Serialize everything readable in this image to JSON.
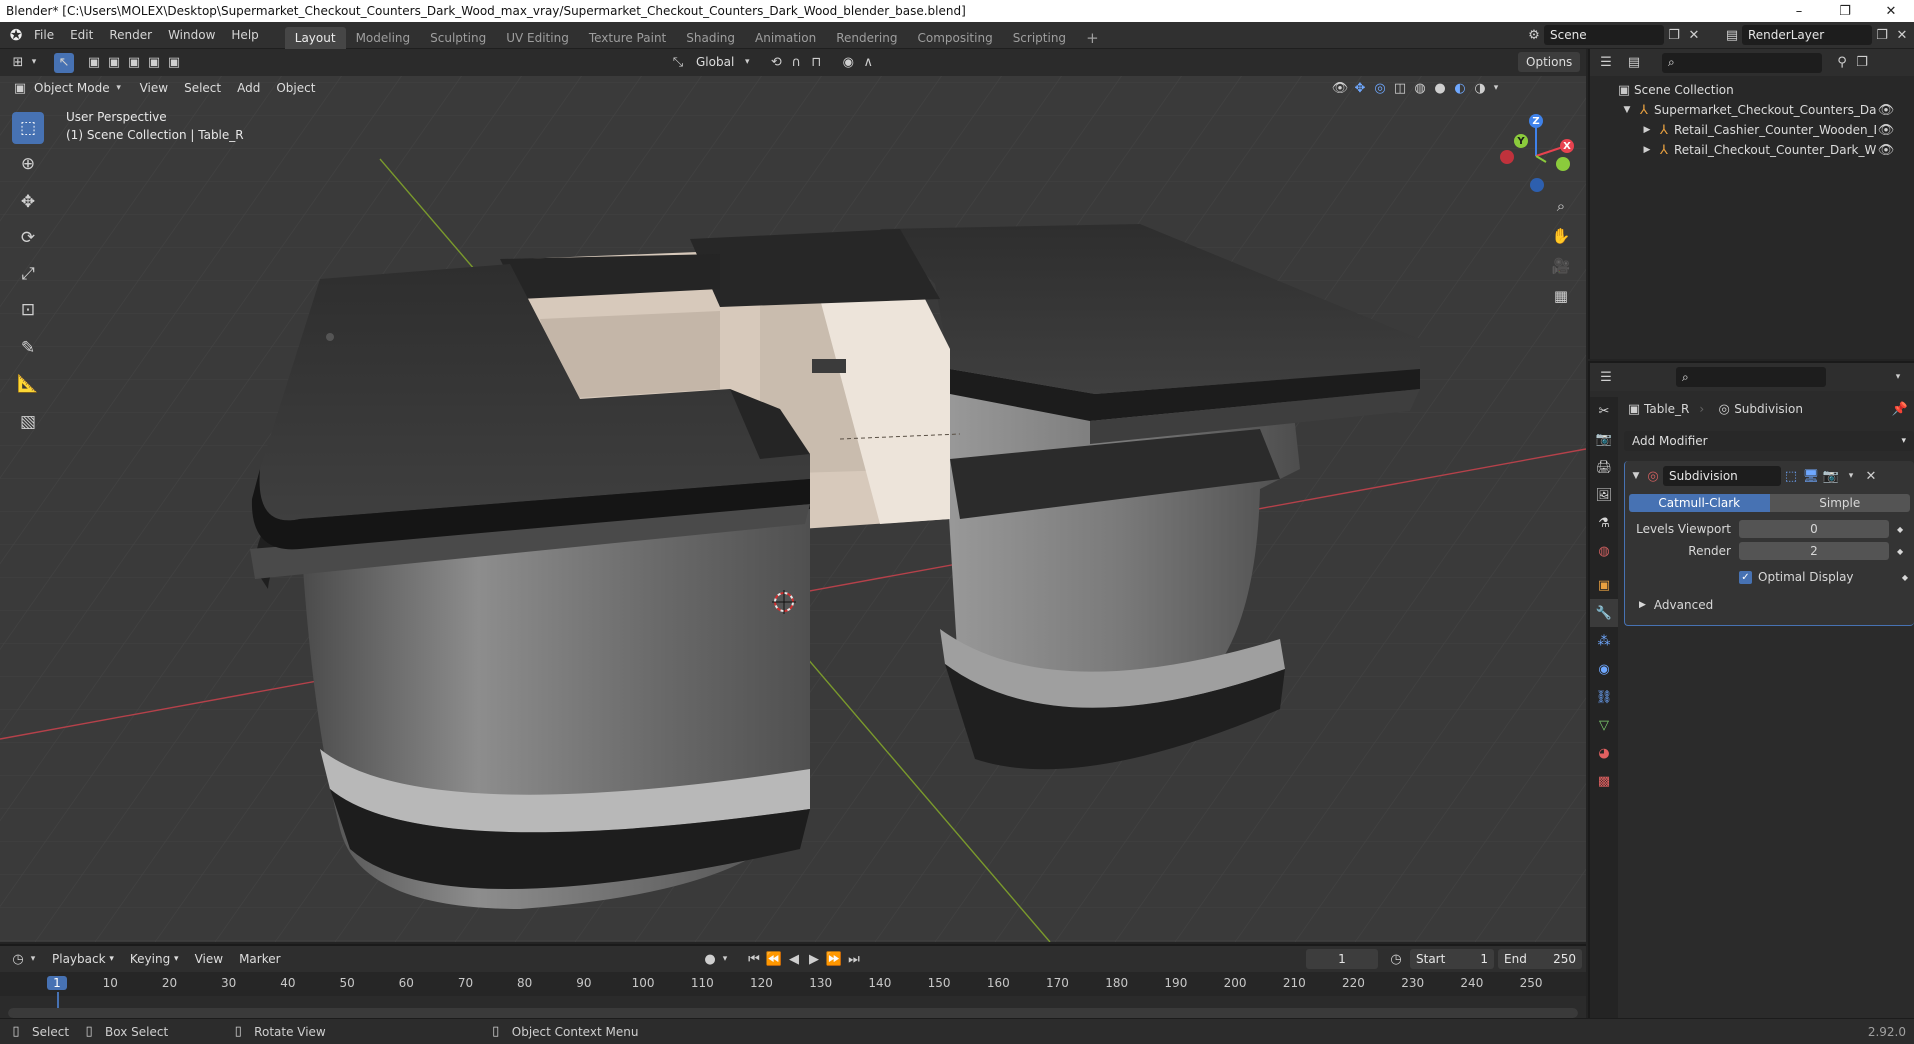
{
  "window": {
    "title": "Blender* [C:\\Users\\MOLEX\\Desktop\\Supermarket_Checkout_Counters_Dark_Wood_max_vray/Supermarket_Checkout_Counters_Dark_Wood_blender_base.blend]",
    "minimize": "–",
    "maximize": "❐",
    "close": "✕"
  },
  "menu": [
    "File",
    "Edit",
    "Render",
    "Window",
    "Help"
  ],
  "workspaces": [
    "Layout",
    "Modeling",
    "Sculpting",
    "UV Editing",
    "Texture Paint",
    "Shading",
    "Animation",
    "Rendering",
    "Compositing",
    "Scripting"
  ],
  "add_workspace": "+",
  "scene": {
    "name": "Scene",
    "render_layer": "RenderLayer"
  },
  "viewport_header": {
    "transform_orientation": "Global",
    "options": "Options",
    "mode": "Object Mode",
    "menus": [
      "View",
      "Select",
      "Add",
      "Object"
    ]
  },
  "viewport": {
    "perspective": "User Perspective",
    "collection_info": "(1) Scene Collection | Table_R",
    "gizmo": {
      "x": "X",
      "y": "Y",
      "z": "Z"
    }
  },
  "outliner": {
    "root": "Scene Collection",
    "items": [
      {
        "name": "Supermarket_Checkout_Counters_Dark_Woc",
        "level": 1,
        "expanded": true
      },
      {
        "name": "Retail_Cashier_Counter_Wooden_Dark",
        "level": 2,
        "expanded": false
      },
      {
        "name": "Retail_Checkout_Counter_Dark_Wood",
        "level": 2,
        "expanded": false
      }
    ]
  },
  "properties": {
    "object_name": "Table_R",
    "modifier_name_crumb": "Subdivision",
    "add_modifier": "Add Modifier",
    "modifier": {
      "name": "Subdivision",
      "type_options": [
        "Catmull-Clark",
        "Simple"
      ],
      "active_type": "Catmull-Clark",
      "levels_viewport_label": "Levels Viewport",
      "levels_viewport": "0",
      "render_label": "Render",
      "render": "2",
      "optimal_display_label": "Optimal Display",
      "optimal_display": true,
      "advanced": "Advanced"
    }
  },
  "timeline": {
    "menus": [
      "Playback",
      "Keying",
      "View",
      "Marker"
    ],
    "current_frame": "1",
    "start_label": "Start",
    "start": "1",
    "end_label": "End",
    "end": "250",
    "ruler_ticks": [
      "1",
      "10",
      "20",
      "30",
      "40",
      "50",
      "60",
      "70",
      "80",
      "90",
      "100",
      "110",
      "120",
      "130",
      "140",
      "150",
      "160",
      "170",
      "180",
      "190",
      "200",
      "210",
      "220",
      "230",
      "240",
      "250"
    ]
  },
  "statusbar": {
    "select": "Select",
    "box_select": "Box Select",
    "rotate_view": "Rotate View",
    "context_menu": "Object Context Menu",
    "version": "2.92.0"
  },
  "colors": {
    "accent": "#4772b3",
    "axis_x": "#e8424f",
    "axis_y": "#8bcb3c",
    "axis_z": "#3f82ea"
  }
}
